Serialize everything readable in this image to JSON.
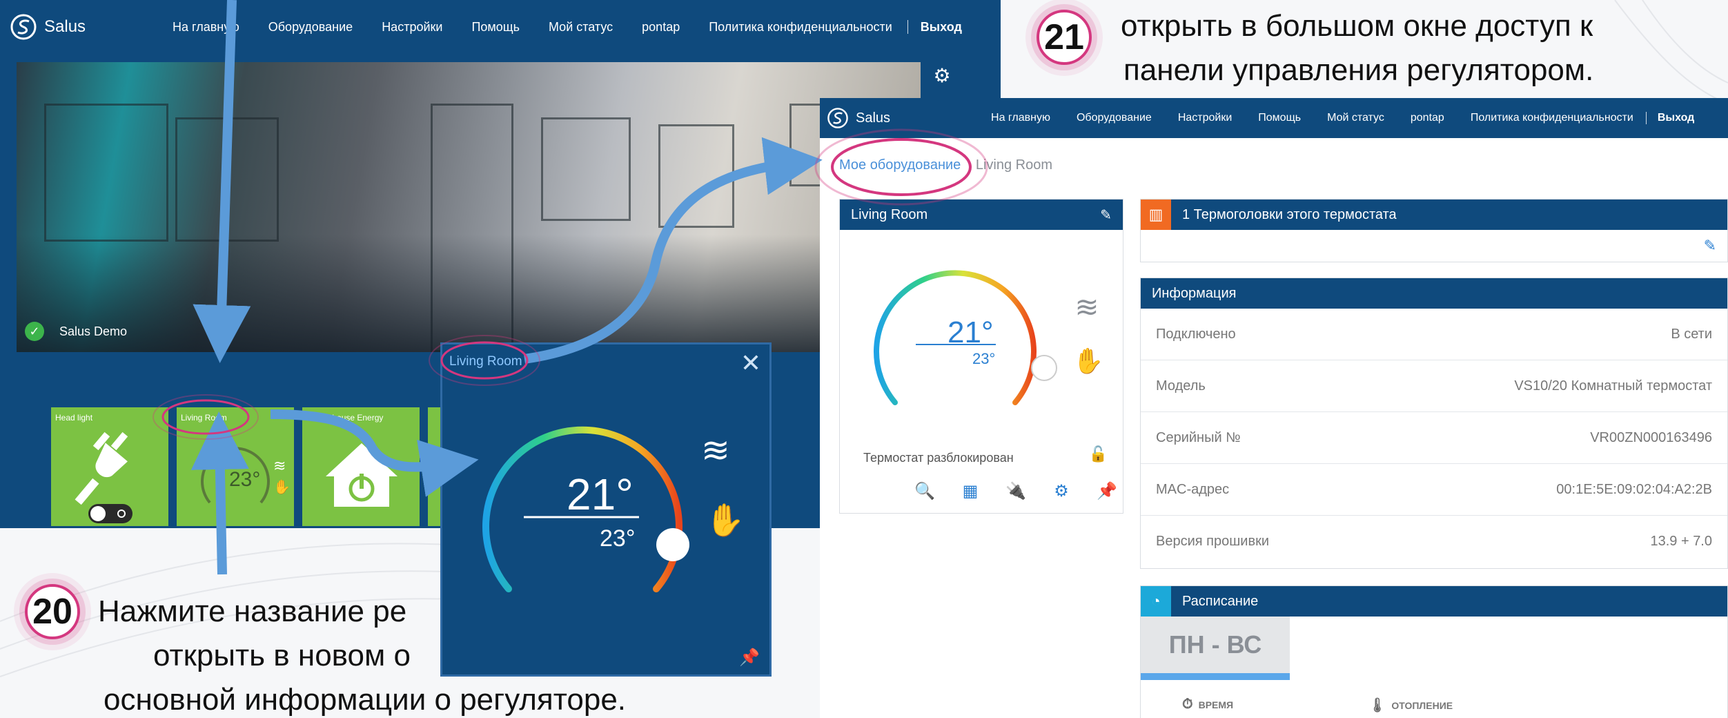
{
  "colors": {
    "nav_bg": "#0f4a7d",
    "tile_green": "#7cc243",
    "link_blue": "#4a90d9",
    "accent_blue": "#2a7fd1",
    "highlight_pink": "#d4377f",
    "arrow_blue": "#5b9bd9"
  },
  "left_screen": {
    "brand": "Salus",
    "nav": [
      "На главную",
      "Оборудование",
      "Настройки",
      "Помощь",
      "Мой статус",
      "pontap",
      "Политика конфиденциальности"
    ],
    "nav_exit": "Выход",
    "site_name": "Salus Demo",
    "tiles": [
      {
        "label": "Head light",
        "icon": "plug-icon"
      },
      {
        "label": "Living Room",
        "icon": "thermostat-icon",
        "value": "23°"
      },
      {
        "label": "Whole house Energy",
        "icon": "house-icon"
      }
    ]
  },
  "popup": {
    "title": "Living Room",
    "current_temp": "21°",
    "target_temp": "23°"
  },
  "right_screen": {
    "brand": "Salus",
    "nav": [
      "На главную",
      "Оборудование",
      "Настройки",
      "Помощь",
      "Мой статус",
      "pontap",
      "Политика конфиденциальности"
    ],
    "nav_exit": "Выход",
    "breadcrumb": {
      "root": "Мое оборудование",
      "current": "Living Room"
    },
    "thermostat": {
      "title": "Living Room",
      "current_temp": "21°",
      "target_temp": "23°",
      "lock_status": "Термостат разблокирован"
    },
    "trv_title": "1 Термоголовки этого термостата",
    "info": {
      "title": "Информация",
      "rows": [
        {
          "label": "Подключено",
          "value": "В сети"
        },
        {
          "label": "Модель",
          "value": "VS10/20 Комнатный термостат"
        },
        {
          "label": "Серийный №",
          "value": "VR00ZN000163496"
        },
        {
          "label": "MAC-адрес",
          "value": "00:1E:5E:09:02:04:A2:2B"
        },
        {
          "label": "Версия прошивки",
          "value": "13.9 + 7.0"
        }
      ]
    },
    "schedule": {
      "title": "Расписание",
      "day_tab": "ПН - ВС",
      "col_time": "ВРЕМЯ",
      "col_heating": "ОТОПЛЕНИЕ"
    }
  },
  "annotations": {
    "step20_number": "20",
    "step20_lines": [
      "Нажмите название ре",
      "открыть в новом о",
      "основной информации о регуляторе."
    ],
    "step21_number": "21",
    "step21_lines": [
      "открыть в большом окне доступ к",
      "панели управления регулятором."
    ]
  }
}
